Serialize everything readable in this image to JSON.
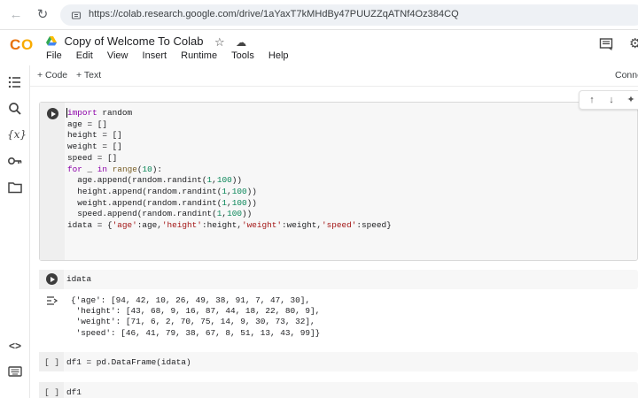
{
  "browser": {
    "url": "https://colab.research.google.com/drive/1aYaxT7kMHdBy47PUUZZqATNf4Oz384CQ"
  },
  "header": {
    "logo_text": "CO",
    "title": "Copy of Welcome To Colab",
    "menu": [
      "File",
      "Edit",
      "View",
      "Insert",
      "Runtime",
      "Tools",
      "Help"
    ]
  },
  "toolbar": {
    "add_code": "+ Code",
    "add_text": "+ Text",
    "connect": "Conne"
  },
  "cells": {
    "cell1": {
      "lines": [
        "import random",
        "age = []",
        "height = []",
        "weight = []",
        "speed = []",
        "for _ in range(10):",
        "  age.append(random.randint(1,100))",
        "  height.append(random.randint(1,100))",
        "  weight.append(random.randint(1,100))",
        "  speed.append(random.randint(1,100))",
        "idata = {'age':age,'height':height,'weight':weight,'speed':speed}"
      ]
    },
    "cell2": {
      "code": "idata",
      "output": [
        "{'age': [94, 42, 10, 26, 49, 38, 91, 7, 47, 30],",
        " 'height': [43, 68, 9, 16, 87, 44, 18, 22, 80, 9],",
        " 'weight': [71, 6, 2, 70, 75, 14, 9, 30, 73, 32],",
        " 'speed': [46, 41, 79, 38, 67, 8, 51, 13, 43, 99]}"
      ]
    },
    "cell3": {
      "bracket": "[ ]",
      "code": "df1 = pd.DataFrame(idata)"
    },
    "cell4": {
      "bracket": "[ ]",
      "code": "df1"
    }
  },
  "colors": {
    "accent_orange": "#F9AB00",
    "accent_orange_dark": "#E8710A",
    "keyword": "#8B00A8",
    "string": "#A31515",
    "number": "#098658"
  }
}
